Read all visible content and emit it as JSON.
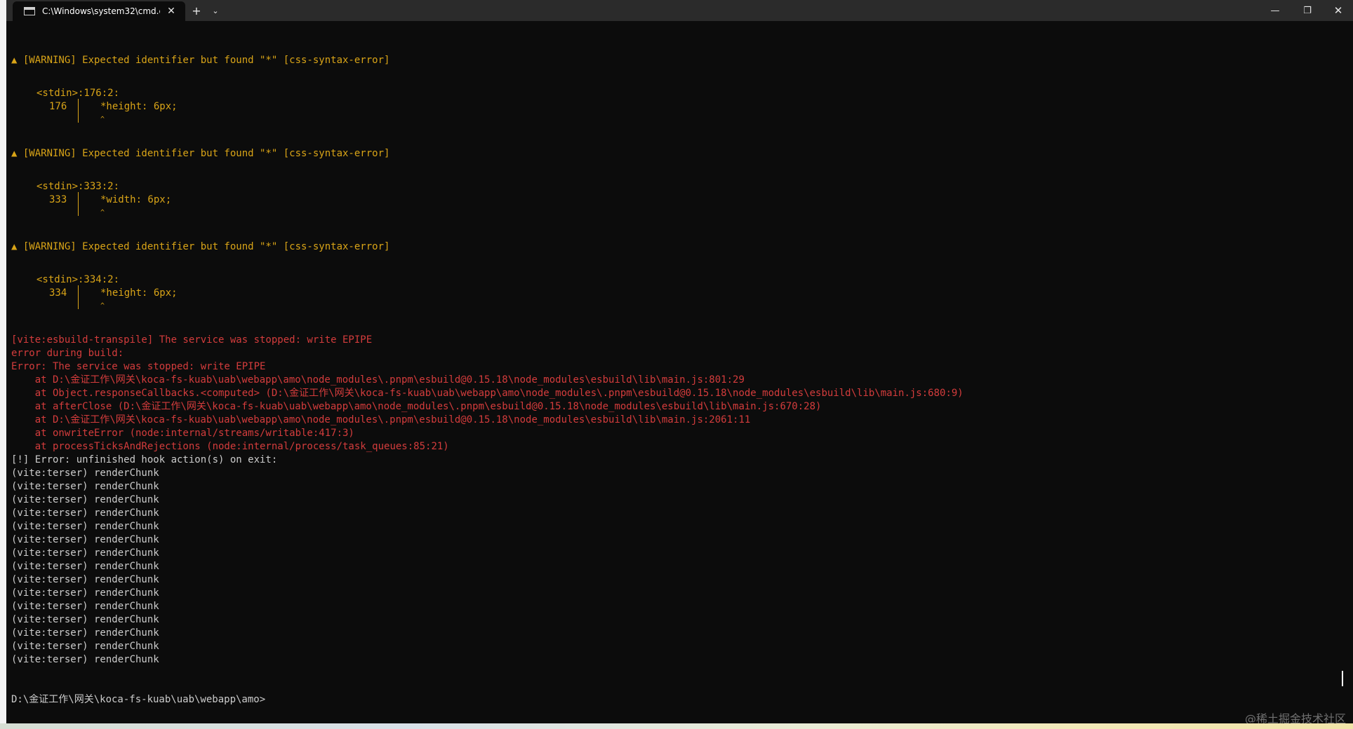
{
  "window": {
    "tab_title": "C:\\Windows\\system32\\cmd.e:",
    "tab_icon": "console-icon",
    "tab_close": "✕",
    "new_tab": "+",
    "dropdown": "⌄",
    "minimize": "—",
    "maximize": "❐",
    "close": "✕"
  },
  "colors": {
    "warning": "#d9a417",
    "error": "#d43c3c",
    "text": "#cccccc",
    "background": "#0c0c0c"
  },
  "warnings": [
    {
      "header": "▲ [WARNING] Expected identifier but found \"*\" [css-syntax-error]",
      "location": "<stdin>:176:2:",
      "line_no": "176",
      "code": "*height: 6px;",
      "caret": "^"
    },
    {
      "header": "▲ [WARNING] Expected identifier but found \"*\" [css-syntax-error]",
      "location": "<stdin>:333:2:",
      "line_no": "333",
      "code": "*width: 6px;",
      "caret": "^"
    },
    {
      "header": "▲ [WARNING] Expected identifier but found \"*\" [css-syntax-error]",
      "location": "<stdin>:334:2:",
      "line_no": "334",
      "code": "*height: 6px;",
      "caret": "^"
    }
  ],
  "errors": [
    "[vite:esbuild-transpile] The service was stopped: write EPIPE",
    "error during build:",
    "Error: The service was stopped: write EPIPE",
    "    at D:\\金证工作\\网关\\koca-fs-kuab\\uab\\webapp\\amo\\node_modules\\.pnpm\\esbuild@0.15.18\\node_modules\\esbuild\\lib\\main.js:801:29",
    "    at Object.responseCallbacks.<computed> (D:\\金证工作\\网关\\koca-fs-kuab\\uab\\webapp\\amo\\node_modules\\.pnpm\\esbuild@0.15.18\\node_modules\\esbuild\\lib\\main.js:680:9)",
    "    at afterClose (D:\\金证工作\\网关\\koca-fs-kuab\\uab\\webapp\\amo\\node_modules\\.pnpm\\esbuild@0.15.18\\node_modules\\esbuild\\lib\\main.js:670:28)",
    "    at D:\\金证工作\\网关\\koca-fs-kuab\\uab\\webapp\\amo\\node_modules\\.pnpm\\esbuild@0.15.18\\node_modules\\esbuild\\lib\\main.js:2061:11",
    "    at onwriteError (node:internal/streams/writable:417:3)",
    "    at processTicksAndRejections (node:internal/process/task_queues:85:21)"
  ],
  "hook_error": "[!] Error: unfinished hook action(s) on exit:",
  "hooks": [
    "(vite:terser) renderChunk",
    "(vite:terser) renderChunk",
    "(vite:terser) renderChunk",
    "(vite:terser) renderChunk",
    "(vite:terser) renderChunk",
    "(vite:terser) renderChunk",
    "(vite:terser) renderChunk",
    "(vite:terser) renderChunk",
    "(vite:terser) renderChunk",
    "(vite:terser) renderChunk",
    "(vite:terser) renderChunk",
    "(vite:terser) renderChunk",
    "(vite:terser) renderChunk",
    "(vite:terser) renderChunk",
    "(vite:terser) renderChunk"
  ],
  "prompt": "D:\\金证工作\\网关\\koca-fs-kuab\\uab\\webapp\\amo>",
  "watermark": "@稀土掘金技术社区"
}
